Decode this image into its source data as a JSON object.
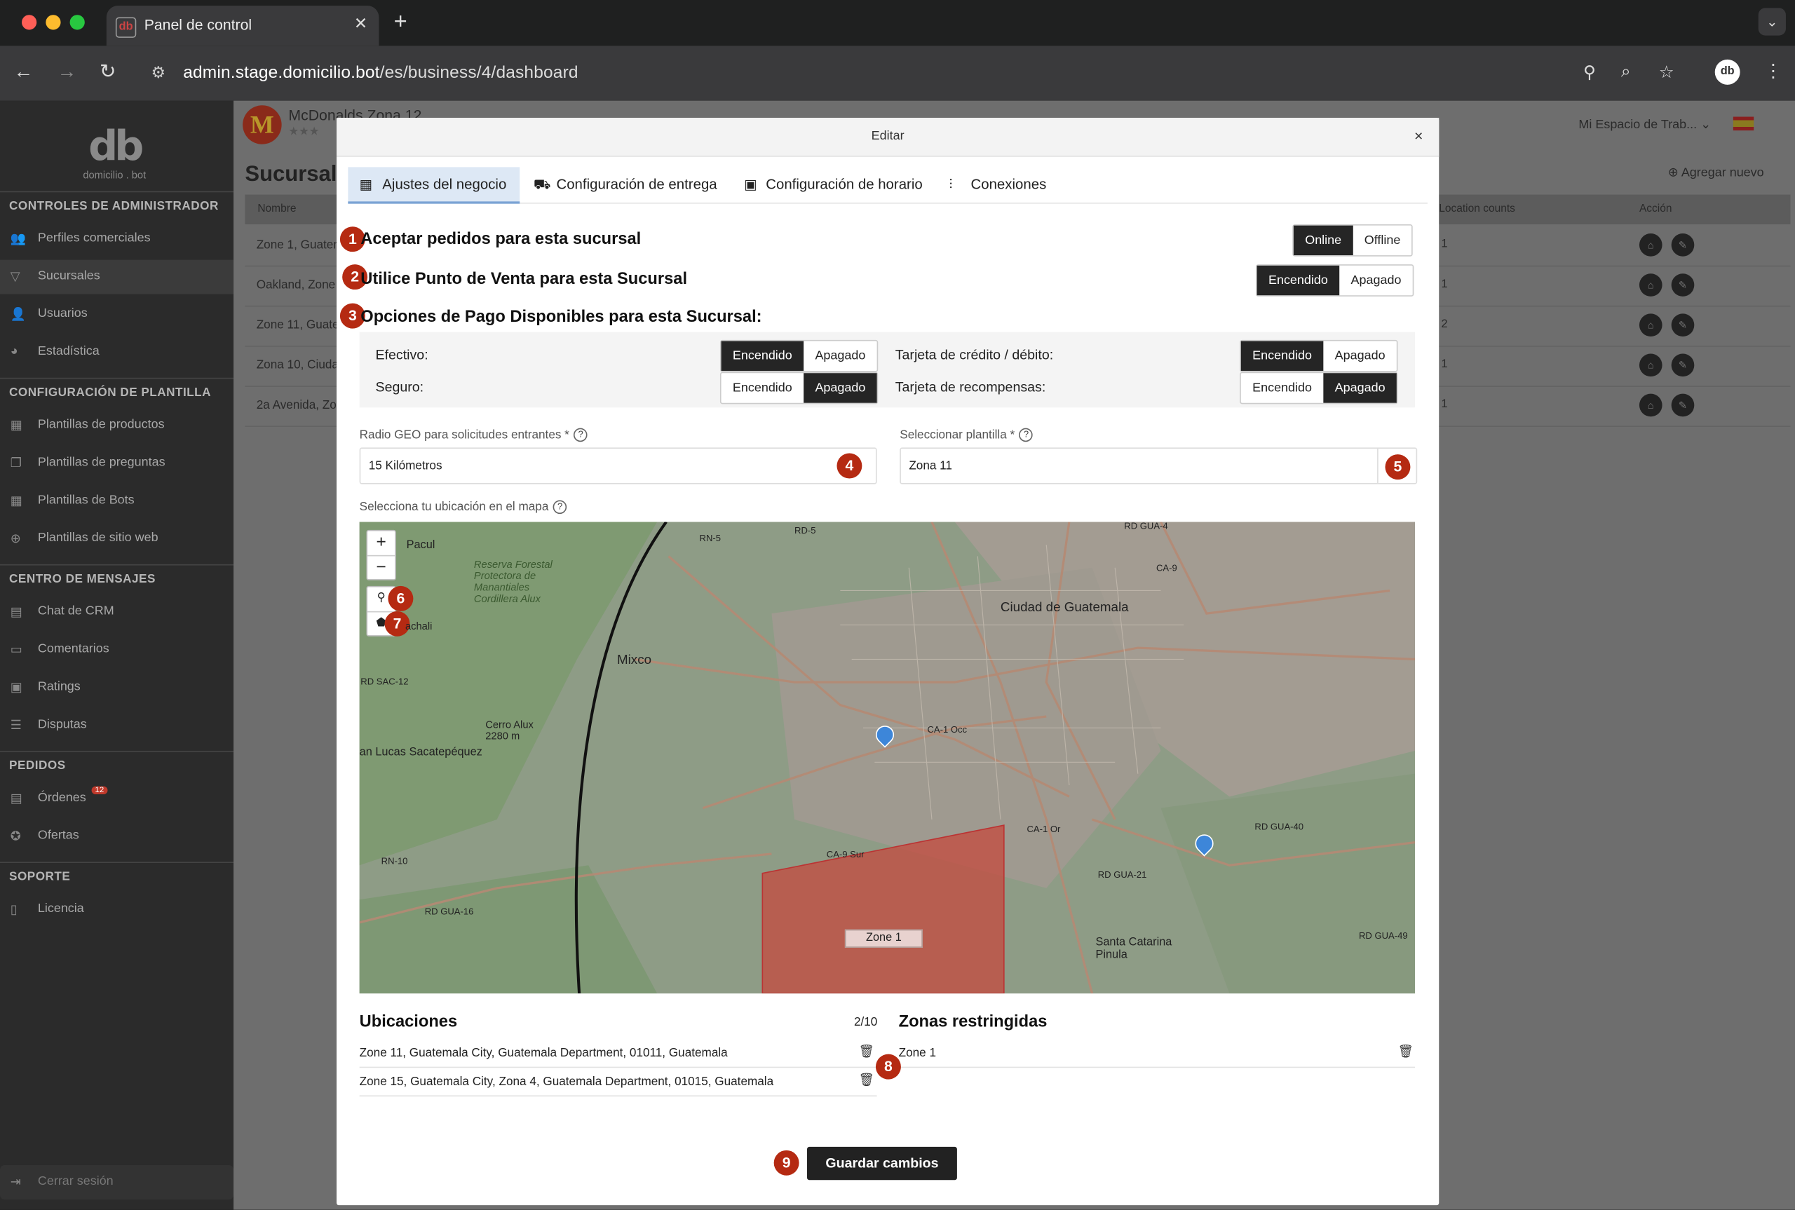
{
  "browser": {
    "tab_title": "Panel de control",
    "tab_favicon": "db",
    "url_host": "admin.stage.domicilio.bot",
    "url_path": "/es/business/4/dashboard",
    "profile_initials": "db"
  },
  "sidebar": {
    "logo_mark": "db",
    "logo_text": "domicilio . bot",
    "sections": [
      {
        "title": "CONTROLES DE ADMINISTRADOR",
        "items": [
          {
            "label": "Perfiles comerciales",
            "icon": "users-icon"
          },
          {
            "label": "Sucursales",
            "icon": "filter-icon",
            "active": true
          },
          {
            "label": "Usuarios",
            "icon": "user-icon"
          },
          {
            "label": "Estadística",
            "icon": "pie-chart-icon"
          }
        ]
      },
      {
        "title": "CONFIGURACIÓN DE PLANTILLA",
        "items": [
          {
            "label": "Plantillas de productos",
            "icon": "grid-icon"
          },
          {
            "label": "Plantillas de preguntas",
            "icon": "copy-icon"
          },
          {
            "label": "Plantillas de Bots",
            "icon": "grid-icon"
          },
          {
            "label": "Plantillas de sitio web",
            "icon": "globe-icon"
          }
        ]
      },
      {
        "title": "CENTRO DE MENSAJES",
        "items": [
          {
            "label": "Chat de CRM",
            "icon": "chat-icon"
          },
          {
            "label": "Comentarios",
            "icon": "comment-icon"
          },
          {
            "label": "Ratings",
            "icon": "rating-icon"
          },
          {
            "label": "Disputas",
            "icon": "dispute-icon"
          }
        ]
      },
      {
        "title": "PEDIDOS",
        "items": [
          {
            "label": "Órdenes",
            "icon": "list-icon",
            "badge": "12"
          },
          {
            "label": "Ofertas",
            "icon": "offer-icon"
          }
        ]
      },
      {
        "title": "SOPORTE",
        "items": [
          {
            "label": "Licencia",
            "icon": "document-icon"
          }
        ]
      }
    ],
    "logout": "Cerrar sesión"
  },
  "background": {
    "brand_name": "McDonalds Zona 12",
    "page_title": "Sucursales",
    "workspace": "Mi Espacio de Trab...",
    "add_new": "Agregar nuevo",
    "columns": {
      "name": "Nombre",
      "location_counts": "Location counts",
      "action": "Acción"
    },
    "rows": [
      {
        "name": "Zone 1, Guatem",
        "count": "1"
      },
      {
        "name": "Oakland, Zone",
        "count": "1"
      },
      {
        "name": "Zone 11, Guate",
        "count": "2"
      },
      {
        "name": "Zona 10, Ciuda",
        "count": "1"
      },
      {
        "name": "2a Avenida, Zo",
        "count": "1"
      }
    ]
  },
  "modal": {
    "title": "Editar",
    "close": "×",
    "tabs": [
      {
        "label": "Ajustes del negocio",
        "icon": "building-icon",
        "active": true
      },
      {
        "label": "Configuración de entrega",
        "icon": "scooter-icon"
      },
      {
        "label": "Configuración de horario",
        "icon": "calendar-icon"
      },
      {
        "label": "Conexiones",
        "icon": "sliders-icon"
      }
    ],
    "accept_orders": {
      "number": "1",
      "label": "Aceptar pedidos para esta sucursal",
      "options": [
        "Online",
        "Offline"
      ],
      "selected": "Online"
    },
    "pos": {
      "number": "2",
      "label": "Utilice Punto de Venta para esta Sucursal",
      "options": [
        "Encendido",
        "Apagado"
      ],
      "selected": "Encendido"
    },
    "payments": {
      "number": "3",
      "label": "Opciones de Pago Disponibles para esta Sucursal:",
      "cash": {
        "label": "Efectivo:",
        "options": [
          "Encendido",
          "Apagado"
        ],
        "selected": "Encendido"
      },
      "card": {
        "label": "Tarjeta de crédito / débito:",
        "options": [
          "Encendido",
          "Apagado"
        ],
        "selected": "Encendido"
      },
      "insurance": {
        "label": "Seguro:",
        "options": [
          "Encendido",
          "Apagado"
        ],
        "selected": "Apagado"
      },
      "rewards": {
        "label": "Tarjeta de recompensas:",
        "options": [
          "Encendido",
          "Apagado"
        ],
        "selected": "Apagado"
      }
    },
    "geo_radius": {
      "label": "Radio GEO para solicitudes entrantes *",
      "value": "15 Kilómetros",
      "number": "4"
    },
    "template": {
      "label": "Seleccionar plantilla *",
      "value": "Zona 11",
      "number": "5"
    },
    "map": {
      "label": "Selecciona tu ubicación en el mapa",
      "zoom_in": "+",
      "zoom_out": "−",
      "marker_tool_number": "6",
      "polygon_tool_number": "7",
      "places": {
        "city": "Ciudad de Guatemala",
        "mixco": "Mixco",
        "pacul": "Pacul",
        "reserve": "Reserva Forestal Protectora de Manantiales Cordillera Alux",
        "cerro": "Cerro Alux 2280 m",
        "san_lucas": "an Lucas Sacatepéquez",
        "santa_catarina": "Santa Catarina Pinula",
        "chachali": "achali",
        "roads": [
          "RN-5",
          "RD-5",
          "RD GUA-4",
          "CA-9",
          "CA-1 Occ",
          "CA-1 Or",
          "CA-9 Sur",
          "RD GUA-40",
          "RD GUA-21",
          "RD GUA-49",
          "RD GUA-16",
          "RD SAC-12",
          "RN-10"
        ]
      },
      "zone_label": "Zone 1"
    },
    "locations": {
      "title": "Ubicaciones",
      "count": "2/10",
      "items": [
        "Zone 11, Guatemala City, Guatemala Department, 01011, Guatemala",
        "Zone 15, Guatemala City, Zona 4, Guatemala Department, 01015, Guatemala"
      ]
    },
    "restricted": {
      "title": "Zonas restringidas",
      "items": [
        "Zone 1"
      ],
      "number": "8"
    },
    "save": {
      "label": "Guardar cambios",
      "number": "9"
    }
  }
}
